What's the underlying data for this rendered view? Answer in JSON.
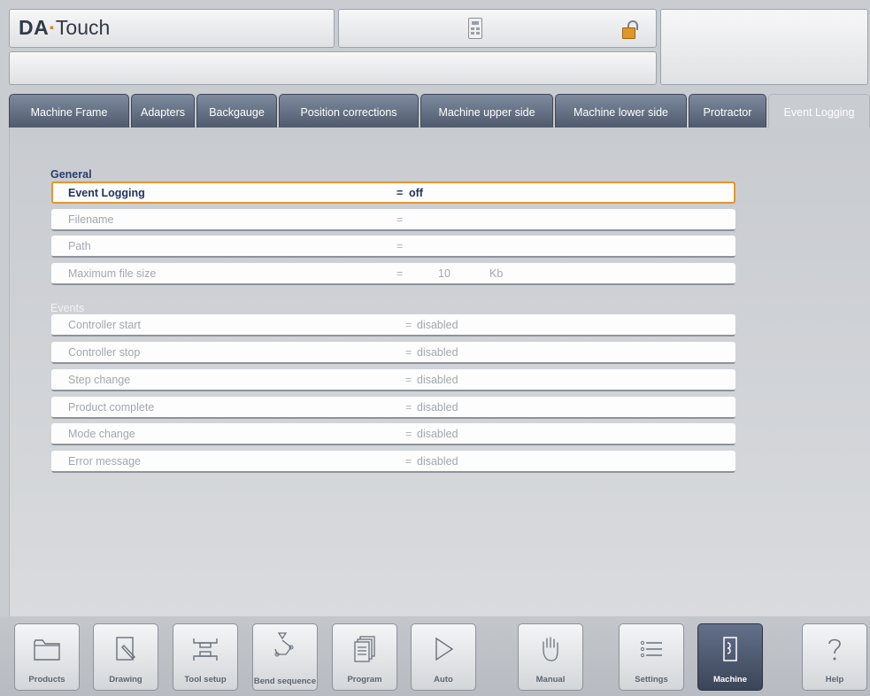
{
  "app": {
    "brand_prefix": "DA",
    "brand_dot": "·",
    "brand_suffix": "Touch"
  },
  "header_icons": [
    "calculator-icon",
    "lock-open-icon"
  ],
  "tabs": [
    {
      "label": "Machine Frame",
      "active": false
    },
    {
      "label": "Adapters",
      "active": false
    },
    {
      "label": "Backgauge",
      "active": false
    },
    {
      "label": "Position corrections",
      "active": false
    },
    {
      "label": "Machine upper side",
      "active": false
    },
    {
      "label": "Machine lower side",
      "active": false
    },
    {
      "label": "Protractor",
      "active": false
    },
    {
      "label": "Event Logging",
      "active": true
    }
  ],
  "general": {
    "label": "General",
    "rows": [
      {
        "label": "Event Logging",
        "eq": "=",
        "value": "off",
        "unit": "",
        "selected": true
      },
      {
        "label": "Filename",
        "eq": "=",
        "value": "",
        "unit": ""
      },
      {
        "label": "Path",
        "eq": "=",
        "value": "",
        "unit": ""
      },
      {
        "label": "Maximum file size",
        "eq": "=",
        "value": "10",
        "unit": "Kb"
      }
    ]
  },
  "events": {
    "label": "Events",
    "rows": [
      {
        "label": "Controller start",
        "eq": "=",
        "value": "disabled"
      },
      {
        "label": "Controller stop",
        "eq": "=",
        "value": "disabled"
      },
      {
        "label": "Step change",
        "eq": "=",
        "value": "disabled"
      },
      {
        "label": "Product complete",
        "eq": "=",
        "value": "disabled"
      },
      {
        "label": "Mode change",
        "eq": "=",
        "value": "disabled"
      },
      {
        "label": "Error message",
        "eq": "=",
        "value": "disabled"
      }
    ]
  },
  "nav": [
    {
      "label": "Products",
      "icon": "folder-icon"
    },
    {
      "label": "Drawing",
      "icon": "pencil-icon"
    },
    {
      "label": "Tool setup",
      "icon": "tool-setup-icon"
    },
    {
      "label": "Bend sequence",
      "icon": "bend-sequence-icon"
    },
    {
      "label": "Program",
      "icon": "program-icon"
    },
    {
      "label": "Auto",
      "icon": "play-icon"
    },
    {
      "label": "Manual",
      "icon": "hand-icon"
    },
    {
      "label": "Settings",
      "icon": "list-icon"
    },
    {
      "label": "Machine",
      "icon": "machine-icon",
      "active": true
    },
    {
      "label": "Help",
      "icon": "help-icon"
    }
  ],
  "colors": {
    "accent_selected": "#e3962e",
    "tab_bg": "#5f6b7e",
    "nav_active_bg": "#4a556a",
    "section_title": "#2a3e6a"
  }
}
